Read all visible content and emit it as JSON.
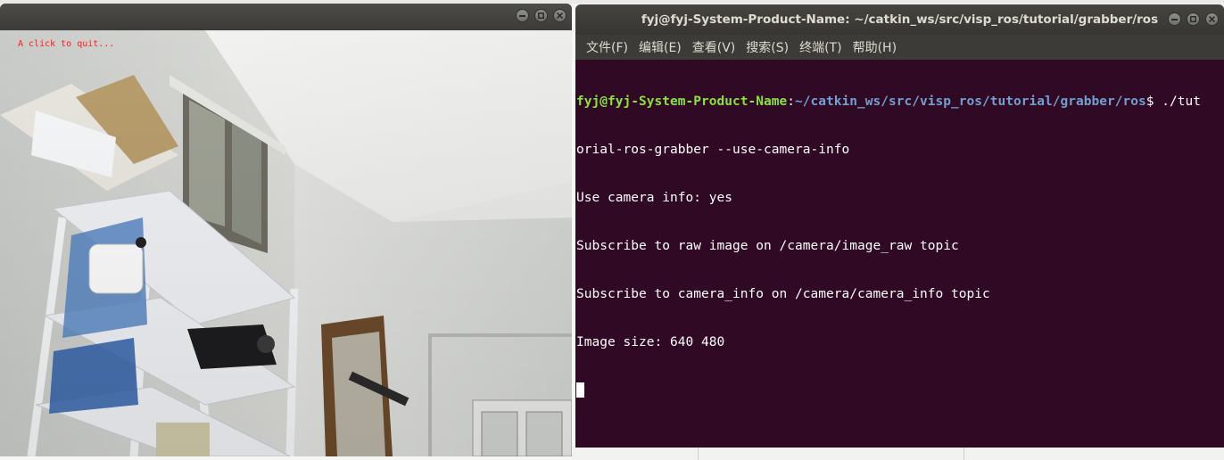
{
  "viewer": {
    "overlay_text": "A click to quit..."
  },
  "terminal": {
    "title": "fyj@fyj-System-Product-Name: ~/catkin_ws/src/visp_ros/tutorial/grabber/ros",
    "menu": [
      "文件(F)",
      "编辑(E)",
      "查看(V)",
      "搜索(S)",
      "终端(T)",
      "帮助(H)"
    ],
    "prompt_user": "fyj@fyj-System-Product-Name",
    "prompt_sep": ":",
    "prompt_path": "~/catkin_ws/src/visp_ros/tutorial/grabber/ros",
    "prompt_cmd": "$ ./tut",
    "command_cont": "orial-ros-grabber --use-camera-info",
    "output": [
      "Use camera info: yes",
      "Subscribe to raw image on /camera/image_raw topic",
      "Subscribe to camera_info on /camera/camera_info topic",
      "Image size: 640 480"
    ]
  },
  "icons": {
    "minimize": "minimize-icon",
    "maximize": "maximize-icon",
    "close": "close-icon"
  },
  "colors": {
    "terminal_bg": "#300a24",
    "prompt_user": "#8ae234",
    "prompt_path": "#729fcf",
    "overlay_text": "#ff1a1a"
  }
}
